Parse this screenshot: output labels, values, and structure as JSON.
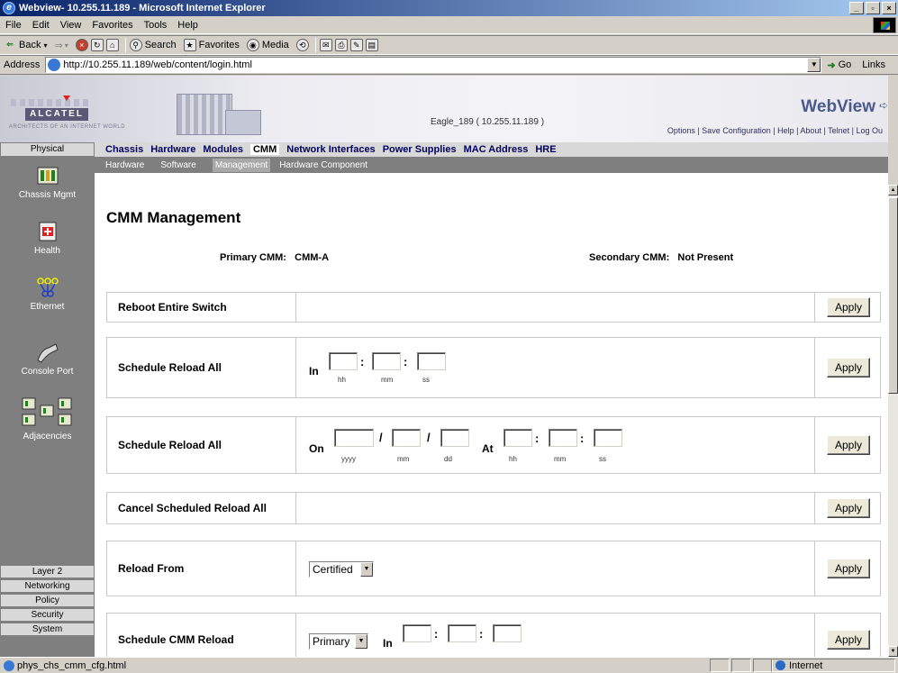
{
  "window": {
    "title": "Webview- 10.255.11.189 - Microsoft Internet Explorer",
    "buttons": {
      "minimize": "_",
      "maximize": "▫",
      "close": "×"
    }
  },
  "menu": [
    "File",
    "Edit",
    "View",
    "Favorites",
    "Tools",
    "Help"
  ],
  "toolbar": {
    "back": "Back",
    "search": "Search",
    "favorites": "Favorites",
    "media": "Media"
  },
  "address": {
    "label": "Address",
    "url": "http://10.255.11.189/web/content/login.html",
    "go": "Go",
    "links": "Links"
  },
  "banner": {
    "logo": "ALCATEL",
    "tagline": "ARCHITECTS OF AN INTERNET WORLD",
    "host": "Eagle_189 ( 10.255.11.189 )",
    "brand": "WebView",
    "nav": "Options | Save Configuration | Help | About | Telnet | Log Ou"
  },
  "sidebar": {
    "physical": "Physical",
    "items": [
      {
        "label": "Chassis Mgmt",
        "icon": "chassis-icon"
      },
      {
        "label": "Health",
        "icon": "health-icon"
      },
      {
        "label": "Ethernet",
        "icon": "ethernet-icon"
      },
      {
        "label": "Console Port",
        "icon": "console-port-icon"
      },
      {
        "label": "Adjacencies",
        "icon": "adjacencies-icon"
      }
    ],
    "bottom": [
      "Layer 2",
      "Networking",
      "Policy",
      "Security",
      "System"
    ]
  },
  "tabs": {
    "items": [
      "Chassis",
      "Hardware",
      "Modules",
      "CMM",
      "Network Interfaces",
      "Power Supplies",
      "MAC Address",
      "HRE"
    ],
    "active": "CMM"
  },
  "subtabs": {
    "items": [
      "Hardware",
      "Software",
      "Management",
      "Hardware Component"
    ],
    "active": "Management"
  },
  "page": {
    "title": "CMM Management",
    "primary_label": "Primary CMM:",
    "primary_value": "CMM-A",
    "secondary_label": "Secondary CMM:",
    "secondary_value": "Not Present"
  },
  "rows": {
    "reboot": {
      "label": "Reboot Entire Switch",
      "apply": "Apply"
    },
    "schedule_in": {
      "label": "Schedule Reload All",
      "prefix": "In",
      "hh": "hh",
      "mm": "mm",
      "ss": "ss",
      "apply": "Apply"
    },
    "schedule_on": {
      "label": "Schedule Reload All",
      "on": "On",
      "yyyy": "yyyy",
      "mm": "mm",
      "dd": "dd",
      "at": "At",
      "hh": "hh",
      "mm2": "mm",
      "ss": "ss",
      "apply": "Apply"
    },
    "cancel": {
      "label": "Cancel Scheduled Reload All",
      "apply": "Apply"
    },
    "reload_from": {
      "label": "Reload From",
      "select": "Certified",
      "apply": "Apply"
    },
    "schedule_cmm": {
      "label": "Schedule CMM Reload",
      "select": "Primary",
      "prefix": "In",
      "apply": "Apply"
    }
  },
  "status": {
    "text": "phys_chs_cmm_cfg.html",
    "zone": "Internet"
  }
}
